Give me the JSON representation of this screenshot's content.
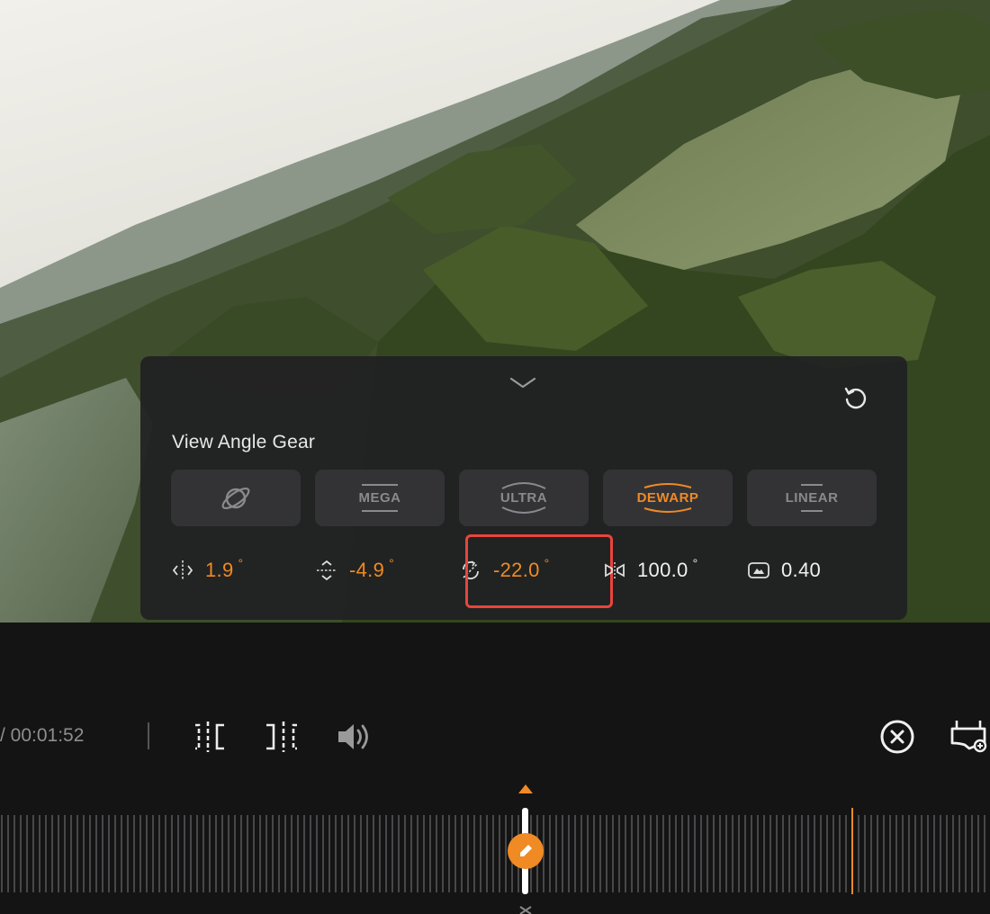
{
  "panel": {
    "title": "View Angle Gear",
    "gears": [
      {
        "id": "planet",
        "label": "",
        "icon": "planet-icon",
        "active": false
      },
      {
        "id": "mega",
        "label": "MEGA",
        "active": false
      },
      {
        "id": "ultra",
        "label": "ULTRA",
        "active": false
      },
      {
        "id": "dewarp",
        "label": "DEWARP",
        "active": true
      },
      {
        "id": "linear",
        "label": "LINEAR",
        "active": false
      }
    ],
    "params": [
      {
        "icon": "pan-icon",
        "value": "1.9",
        "unit": "°"
      },
      {
        "icon": "tilt-icon",
        "value": "-4.9",
        "unit": "°"
      },
      {
        "icon": "roll-icon",
        "value": "-22.0",
        "unit": "°"
      },
      {
        "icon": "fov-icon",
        "value": "100.0",
        "unit": "°"
      },
      {
        "icon": "distortion-icon",
        "value": "0.40",
        "unit": ""
      }
    ]
  },
  "playback": {
    "time": "/ 00:01:52"
  },
  "colors": {
    "accent": "#f08a24",
    "highlight": "#e8453c",
    "panel_bg": "#202022"
  }
}
